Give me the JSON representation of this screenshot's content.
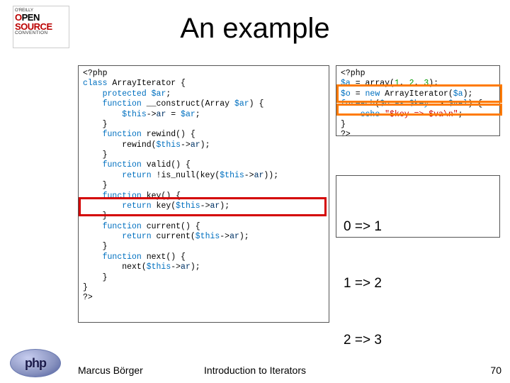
{
  "logo": {
    "vendor": "O'REILLY",
    "line1": "OPEN",
    "line2": "SOURCE",
    "line3": "CONVENTION"
  },
  "title": "An example",
  "code_left_raw": "<?php\nclass ArrayIterator {\n    protected $ar;\n    function __construct(Array $ar) {\n        $this->ar = $ar;\n    }\n    function rewind() {\n        rewind($this->ar);\n    }\n    function valid() {\n        return !is_null(key($this->ar));\n    }\n    function key() {\n        return key($this->ar);\n    }\n    function current() {\n        return current($this->ar);\n    }\n    function next() {\n        next($this->ar);\n    }\n}\n?>",
  "code_right_raw": "<?php\n$a = array(1, 2, 3);\n$o = new ArrayIterator($a);\nforeach($o as $key => $val) {\n    echo \"$key => $va\\n\";\n}\n?>",
  "output": {
    "lines": [
      "0 => 1",
      "1 => 2",
      "2 => 3"
    ]
  },
  "footer": {
    "author": "Marcus Börger",
    "center": "Introduction to Iterators",
    "page": "70"
  },
  "php_logo_text": "php"
}
